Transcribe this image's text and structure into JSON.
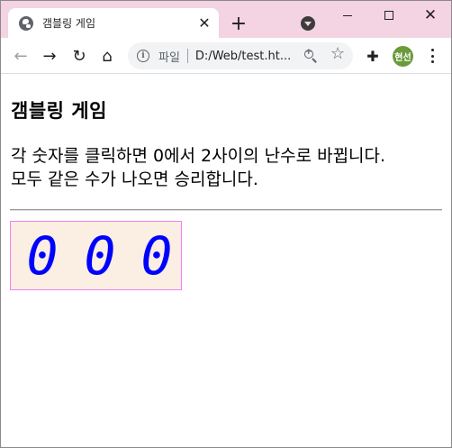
{
  "browser": {
    "tab": {
      "title": "갬블링 게임",
      "close_glyph": "✕",
      "favicon": "globe-icon"
    },
    "new_tab_glyph": "+",
    "window_controls": {
      "close_glyph": "✕"
    },
    "toolbar": {
      "back_glyph": "←",
      "forward_glyph": "→",
      "reload_glyph": "↻",
      "home_glyph": "⌂",
      "info_glyph": "i",
      "address_label": "파일",
      "address_url": "D:/Web/test.ht...",
      "star_glyph": "☆",
      "extensions_glyph": "✚",
      "profile_initials": "현선"
    }
  },
  "page": {
    "title": "갬블링 게임",
    "description_line1": "각 숫자를 클릭하면 0에서 2사이의 난수로 바뀝니다.",
    "description_line2": "모두 같은 수가 나오면 승리합니다.",
    "digits": [
      "0",
      "0",
      "0"
    ]
  },
  "colors": {
    "tab_strip": "#f4d3e3",
    "game_box_bg": "#fbeee3",
    "game_box_border": "#ee82ee",
    "digit_color": "#0000ff",
    "avatar_bg": "#6a9a3c"
  }
}
